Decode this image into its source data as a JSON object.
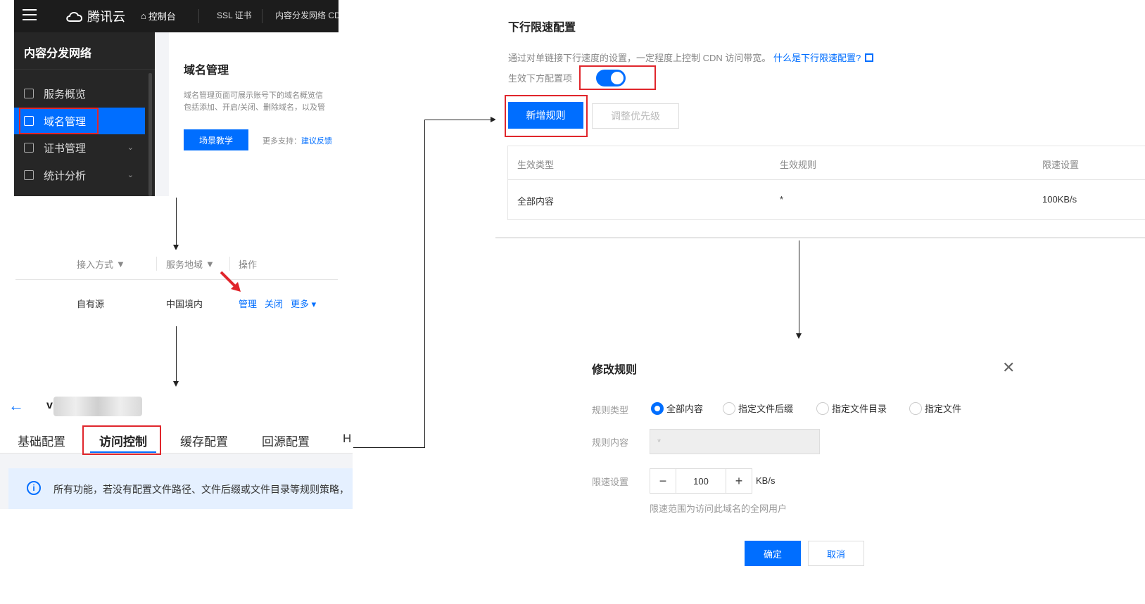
{
  "console": {
    "brand": "腾讯云",
    "home": "控制台",
    "nav": [
      "SSL 证书",
      "内容分发网络 CD"
    ],
    "sidebar_title": "内容分发网络",
    "sidebar_items": [
      {
        "label": "服务概览",
        "icon": "dashboard-icon"
      },
      {
        "label": "域名管理",
        "icon": "domain-icon"
      },
      {
        "label": "证书管理",
        "icon": "certificate-icon"
      },
      {
        "label": "统计分析",
        "icon": "chart-icon"
      }
    ],
    "card_title": "域名管理",
    "card_desc_line1": "域名管理页面可展示账号下的域名概览信",
    "card_desc_line2": "包括添加、开启/关闭、删除域名，以及管",
    "card_button": "场景教学",
    "more_support_label": "更多支持：",
    "more_support_link": "建议反馈"
  },
  "domain_list": {
    "columns": [
      "接入方式",
      "服务地域",
      "操作"
    ],
    "row": {
      "access": "自有源",
      "region": "中国境内"
    },
    "actions": [
      "管理",
      "关闭",
      "更多"
    ]
  },
  "domain_detail": {
    "domain_initial": "v",
    "tabs": [
      "基础配置",
      "访问控制",
      "缓存配置",
      "回源配置",
      "H"
    ],
    "notice": "所有功能，若没有配置文件路径、文件后缀或文件目录等规则策略，"
  },
  "rate_limit": {
    "title": "下行限速配置",
    "desc": "通过对单链接下行速度的设置，一定程度上控制 CDN 访问带宽。",
    "help_link": "什么是下行限速配置?",
    "toggle_label": "生效下方配置项",
    "toggle_on": true,
    "add_button": "新增规则",
    "priority_button": "调整优先级",
    "columns": [
      "生效类型",
      "生效规则",
      "限速设置"
    ],
    "rows": [
      {
        "type": "全部内容",
        "rule": "*",
        "limit": "100KB/s"
      }
    ]
  },
  "modify_dialog": {
    "title": "修改规则",
    "rule_type_label": "规则类型",
    "rule_types": [
      "全部内容",
      "指定文件后缀",
      "指定文件目录",
      "指定文件"
    ],
    "selected_rule_type": "全部内容",
    "rule_content_label": "规则内容",
    "rule_content_value": "*",
    "limit_label": "限速设置",
    "limit_value": "100",
    "limit_unit": "KB/s",
    "hint": "限速范围为访问此域名的全网用户",
    "ok": "确定",
    "cancel": "取消"
  },
  "colors": {
    "accent": "#006eff",
    "highlight": "#e0262c",
    "sidebar": "#262626"
  }
}
